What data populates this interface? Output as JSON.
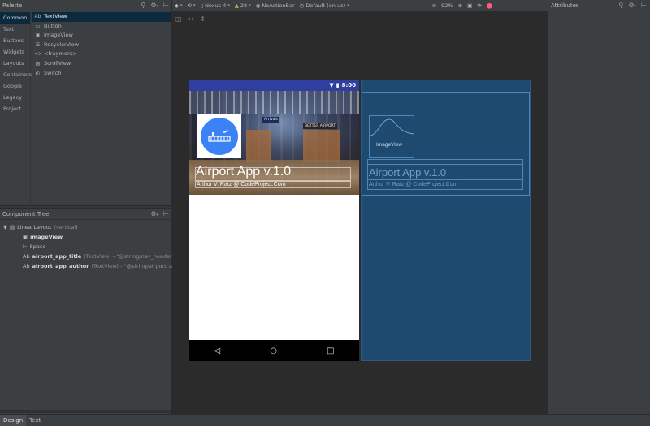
{
  "palette": {
    "title": "Palette",
    "categories": [
      "Common",
      "Text",
      "Buttons",
      "Widgets",
      "Layouts",
      "Containers",
      "Google",
      "Legacy",
      "Project"
    ],
    "items": [
      {
        "icon": "Ab",
        "label": "TextView"
      },
      {
        "icon": "▭",
        "label": "Button"
      },
      {
        "icon": "▣",
        "label": "ImageView"
      },
      {
        "icon": "☰",
        "label": "RecyclerView"
      },
      {
        "icon": "<>",
        "label": "<fragment>"
      },
      {
        "icon": "▤",
        "label": "ScrollView"
      },
      {
        "icon": "◐",
        "label": "Switch"
      }
    ]
  },
  "toolbar": {
    "device": "Nexus 4",
    "api": "28",
    "theme": "NoActionBar",
    "locale": "Default (en-us)",
    "zoom": "92%"
  },
  "attributes": {
    "title": "Attributes"
  },
  "component_tree": {
    "title": "Component Tree",
    "rows": [
      {
        "icon": "▤",
        "name": "LinearLayout",
        "detail": "(vertical)"
      },
      {
        "icon": "▣",
        "name": "imageView",
        "detail": ""
      },
      {
        "icon": "⊢",
        "name": "Space",
        "detail": ""
      },
      {
        "icon": "Ab",
        "name": "airport_app_title",
        "detail": "(TextView) - \"@string/nav_header\""
      },
      {
        "icon": "Ab",
        "name": "airport_app_author",
        "detail": "(TextView) - \"@string/airport_app_..."
      }
    ]
  },
  "phone": {
    "clock": "8:00",
    "title": "Airport App v.1.0",
    "author": "Arthur V. Ratz @ CodeProject.Com",
    "signs": [
      "Arrivals",
      "BETTER AIRPORT"
    ]
  },
  "blueprint": {
    "image_label": "ImageView",
    "title": "Airport App v.1.0",
    "author": "Arthur V. Ratz @ CodeProject.Com"
  },
  "bottom_tabs": [
    "Design",
    "Text"
  ],
  "colors": {
    "accent_blue": "#3b82f6",
    "status_bar": "#303f9f",
    "blueprint_bg": "#1f4a70"
  }
}
